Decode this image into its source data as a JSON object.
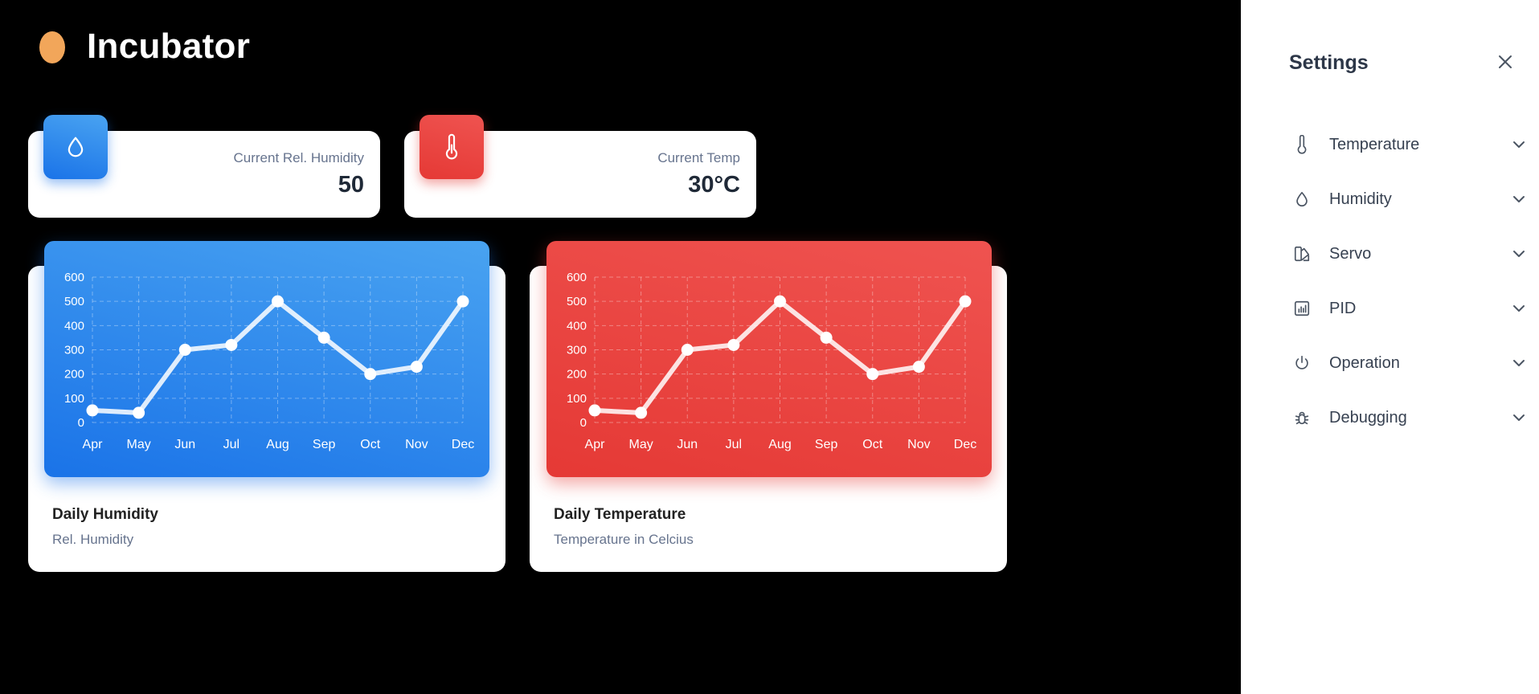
{
  "app": {
    "title": "Incubator",
    "icon": "egg-icon"
  },
  "colors": {
    "humidity_accent": "#1a73e8",
    "temperature_accent": "#e53935",
    "egg": "#f2a65a"
  },
  "stats": [
    {
      "id": "humidity",
      "label": "Current Rel. Humidity",
      "value": "50",
      "icon": "droplet-icon"
    },
    {
      "id": "temp",
      "label": "Current Temp",
      "value": "30°C",
      "icon": "thermometer-icon"
    }
  ],
  "charts": [
    {
      "id": "humidity",
      "title": "Daily Humidity",
      "subtitle": "Rel. Humidity"
    },
    {
      "id": "temp",
      "title": "Daily Temperature",
      "subtitle": "Temperature in Celcius"
    }
  ],
  "chart_data": [
    {
      "type": "line",
      "title": "Daily Humidity",
      "subtitle": "Rel. Humidity",
      "categories": [
        "Apr",
        "May",
        "Jun",
        "Jul",
        "Aug",
        "Sep",
        "Oct",
        "Nov",
        "Dec"
      ],
      "values": [
        50,
        40,
        300,
        320,
        500,
        350,
        200,
        230,
        500
      ],
      "ylim": [
        0,
        600
      ],
      "yticks": [
        0,
        100,
        200,
        300,
        400,
        500,
        600
      ],
      "grid": true
    },
    {
      "type": "line",
      "title": "Daily Temperature",
      "subtitle": "Temperature in Celcius",
      "categories": [
        "Apr",
        "May",
        "Jun",
        "Jul",
        "Aug",
        "Sep",
        "Oct",
        "Nov",
        "Dec"
      ],
      "values": [
        50,
        40,
        300,
        320,
        500,
        350,
        200,
        230,
        500
      ],
      "ylim": [
        0,
        600
      ],
      "yticks": [
        0,
        100,
        200,
        300,
        400,
        500,
        600
      ],
      "grid": true
    }
  ],
  "settings": {
    "title": "Settings",
    "close_icon": "close-icon",
    "items": [
      {
        "id": "temperature",
        "label": "Temperature",
        "icon": "thermometer-icon"
      },
      {
        "id": "humidity",
        "label": "Humidity",
        "icon": "droplet-icon"
      },
      {
        "id": "servo",
        "label": "Servo",
        "icon": "servo-icon"
      },
      {
        "id": "pid",
        "label": "PID",
        "icon": "bar-chart-icon"
      },
      {
        "id": "operation",
        "label": "Operation",
        "icon": "power-icon"
      },
      {
        "id": "debugging",
        "label": "Debugging",
        "icon": "bug-icon"
      }
    ]
  }
}
